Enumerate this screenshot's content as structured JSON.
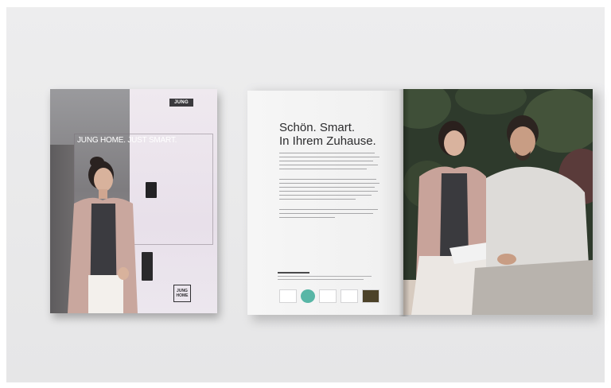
{
  "cover": {
    "logo": "JUNG",
    "title": "JUNG HOME. JUST SMART.",
    "badge_line1": "JUNG",
    "badge_line2": "HOME"
  },
  "spread": {
    "headline_line1": "Schön. Smart.",
    "headline_line2": "In Ihrem Zuhause."
  },
  "colors": {
    "background": "#e9e9ea",
    "foliage": "#2d3a2b",
    "accent_teal": "#58b6a6"
  }
}
